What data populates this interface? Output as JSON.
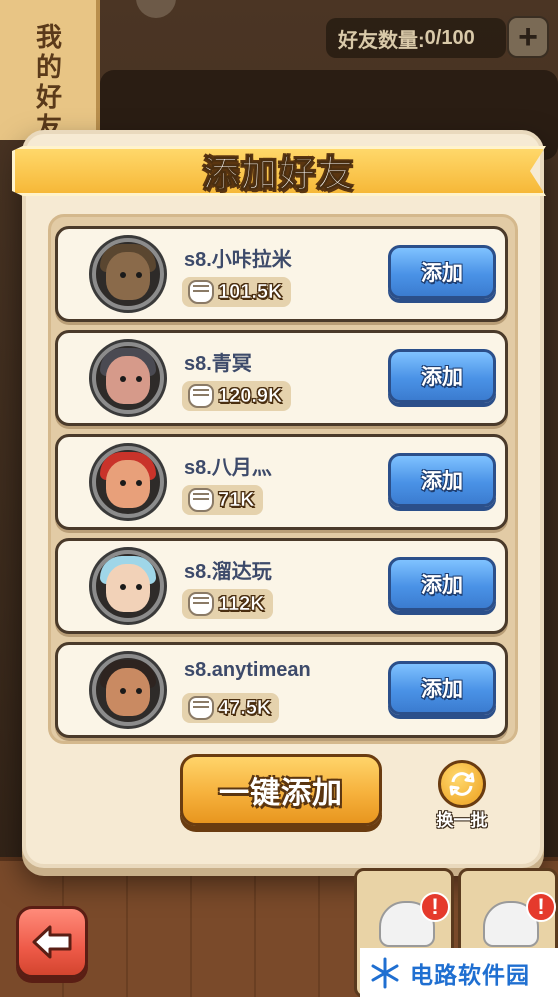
{
  "background": {
    "side_banner_text": "我的好友",
    "friend_count_label": "好友数量:",
    "friend_count_value": "0/100",
    "add_slot_label": "+"
  },
  "dialog": {
    "title": "添加好友",
    "add_button_label": "添加",
    "friends": [
      {
        "name": "s8.小咔拉米",
        "power": "101.5K",
        "avatar": "gorilla-warrior-avatar"
      },
      {
        "name": "s8.青冥",
        "power": "120.9K",
        "avatar": "wolf-hood-boar-avatar"
      },
      {
        "name": "s8.八月灬",
        "power": "71K",
        "avatar": "red-bearded-viking-avatar"
      },
      {
        "name": "s8.溜达玩",
        "power": "112K",
        "avatar": "blue-haired-elf-avatar"
      },
      {
        "name": "s8.anytimean",
        "power": "47.5K",
        "avatar": "bald-brute-avatar"
      }
    ],
    "add_all_label": "一键添加",
    "refresh_label": "换一批"
  },
  "footer": {
    "alert_mark": "!",
    "watermark_text": "电路软件园"
  },
  "colors": {
    "add_button": "#4a92e6",
    "add_all_button": "#f6b13c",
    "back_button": "#ee5a48",
    "title_ribbon": "#f6b838",
    "name_text": "#3d4a6a"
  }
}
